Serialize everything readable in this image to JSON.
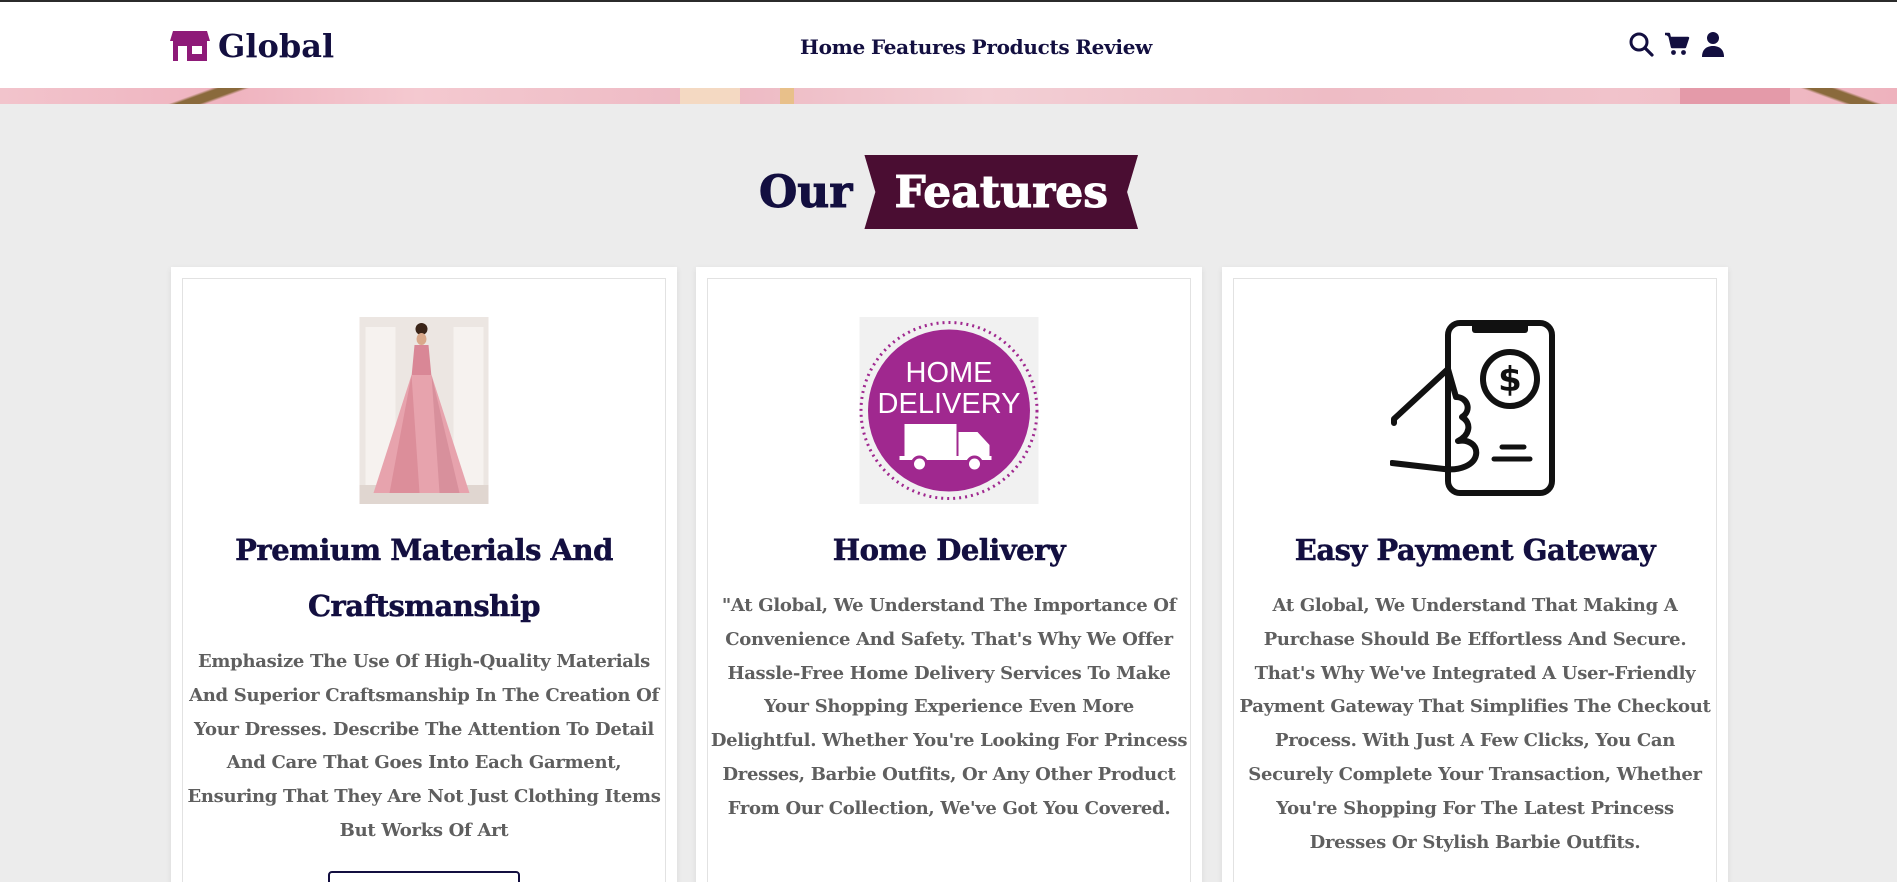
{
  "brand": {
    "name": "Global",
    "logo_icon": "shop-icon",
    "accent": "#8e1a78"
  },
  "nav": [
    {
      "label": "Home"
    },
    {
      "label": "Features"
    },
    {
      "label": "Products"
    },
    {
      "label": "Review"
    }
  ],
  "header_icons": [
    "search-icon",
    "cart-icon",
    "user-icon"
  ],
  "section": {
    "title_plain": "Our",
    "title_highlight": "Features",
    "ribbon_color": "#4a0d32"
  },
  "cards": [
    {
      "image": "pink-gown-photo",
      "title": "Premium Materials And Craftsmanship",
      "text": "Emphasize The Use Of High-Quality Materials And Superior Craftsmanship In The Creation Of Your Dresses. Describe The Attention To Detail And Care That Goes Into Each Garment, Ensuring That They Are Not Just Clothing Items But Works Of Art"
    },
    {
      "image": "home-delivery-badge",
      "image_text": [
        "HOME",
        "DELIVERY"
      ],
      "title": "Home Delivery",
      "text": "\"At Global, We Understand The Importance Of Convenience And Safety. That's Why We Offer Hassle-Free Home Delivery Services To Make Your Shopping Experience Even More Delightful. Whether You're Looking For Princess Dresses, Barbie Outfits, Or Any Other Product From Our Collection, We've Got You Covered."
    },
    {
      "image": "hand-phone-payment-icon",
      "title": "Easy Payment Gateway",
      "text": "At Global, We Understand That Making A Purchase Should Be Effortless And Secure. That's Why We've Integrated A User-Friendly Payment Gateway That Simplifies The Checkout Process. With Just A Few Clicks, You Can Securely Complete Your Transaction, Whether You're Shopping For The Latest Princess Dresses Or Stylish Barbie Outfits."
    }
  ]
}
